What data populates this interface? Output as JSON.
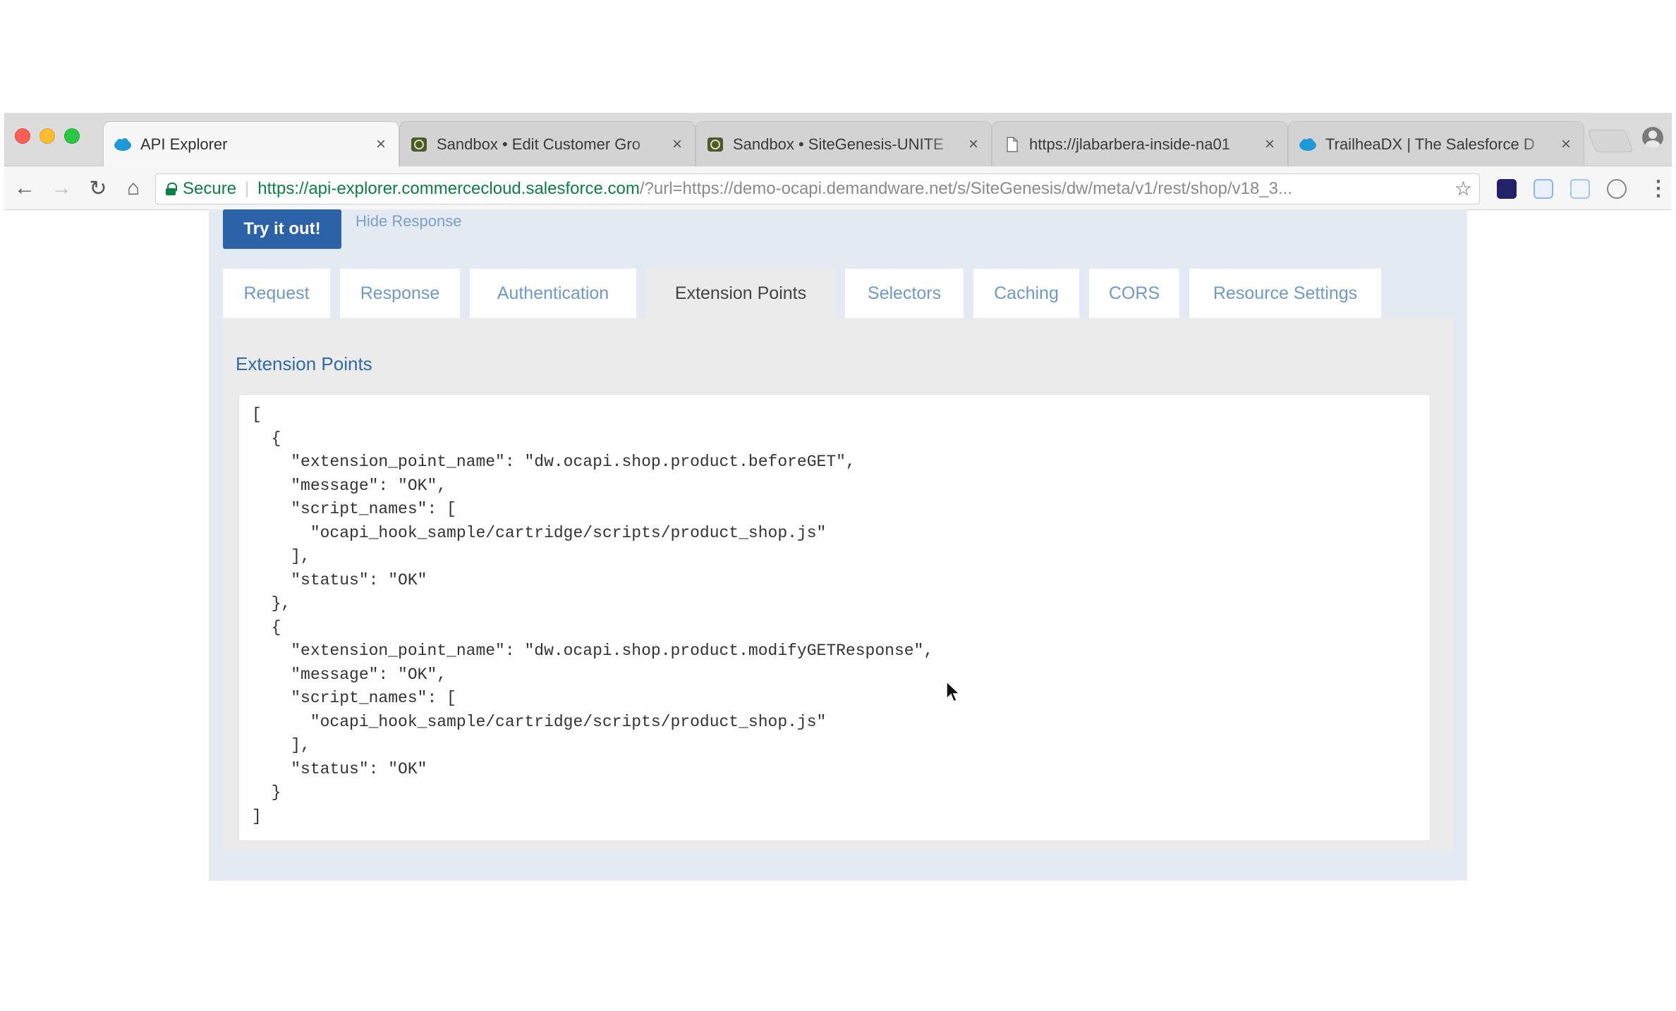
{
  "browser": {
    "tabs": [
      {
        "title": "API Explorer",
        "favicon": "salesforce-cloud-icon",
        "active": true
      },
      {
        "title": "Sandbox • Edit Customer Gro",
        "favicon": "sandbox-icon",
        "active": false
      },
      {
        "title": "Sandbox • SiteGenesis-UNITE",
        "favicon": "sandbox-icon",
        "active": false
      },
      {
        "title": "https://jlabarbera-inside-na01",
        "favicon": "page-icon",
        "active": false
      },
      {
        "title": "TrailheaDX | The Salesforce D",
        "favicon": "salesforce-cloud-icon",
        "active": false
      }
    ],
    "close_glyph": "×",
    "address_bar": {
      "secure_label": "Secure",
      "divider": "|",
      "url_main": "https://api-explorer.commercecloud.salesforce.com",
      "url_rest": "/?url=https://demo-ocapi.demandware.net/s/SiteGenesis/dw/meta/v1/rest/shop/v18_3..."
    },
    "nav_icons": {
      "back": "←",
      "forward": "→",
      "reload": "↻",
      "home": "⌂",
      "star": "☆",
      "menu": "⋮"
    }
  },
  "page": {
    "try_button": "Try it out!",
    "hide_response_link": "Hide Response",
    "tabs": [
      {
        "label": "Request",
        "active": false
      },
      {
        "label": "Response",
        "active": false
      },
      {
        "label": "Authentication",
        "active": false
      },
      {
        "label": "Extension Points",
        "active": true
      },
      {
        "label": "Selectors",
        "active": false
      },
      {
        "label": "Caching",
        "active": false
      },
      {
        "label": "CORS",
        "active": false
      },
      {
        "label": "Resource Settings",
        "active": false
      }
    ],
    "section_title": "Extension Points",
    "code_lines": [
      "[",
      "  {",
      "    \"extension_point_name\": \"dw.ocapi.shop.product.beforeGET\",",
      "    \"message\": \"OK\",",
      "    \"script_names\": [",
      "      \"ocapi_hook_sample/cartridge/scripts/product_shop.js\"",
      "    ],",
      "    \"status\": \"OK\"",
      "  },",
      "  {",
      "    \"extension_point_name\": \"dw.ocapi.shop.product.modifyGETResponse\",",
      "    \"message\": \"OK\",",
      "    \"script_names\": [",
      "      \"ocapi_hook_sample/cartridge/scripts/product_shop.js\"",
      "    ],",
      "    \"status\": \"OK\"",
      "  }",
      "]"
    ]
  },
  "colors": {
    "primary_button": "#2c63a8",
    "link": "#7c9fca",
    "title": "#2f6aa7",
    "secure_green": "#0b8043"
  }
}
